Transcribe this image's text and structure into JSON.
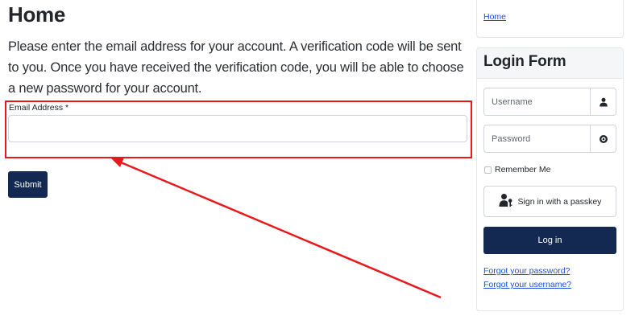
{
  "main": {
    "heading": "Home",
    "intro": "Please enter the email address for your account. A verification code will be sent to you. Once you have received the verification code, you will be able to choose a new password for your account.",
    "email_label": "Email Address *",
    "email_value": "",
    "submit_label": "Submit"
  },
  "sidebar": {
    "breadcrumb": "Home",
    "login_form": {
      "title": "Login Form",
      "username_placeholder": "Username",
      "password_placeholder": "Password",
      "remember_label": "Remember Me",
      "passkey_label": "Sign in with a passkey",
      "login_label": "Log in",
      "forgot_password": "Forgot your password?",
      "forgot_username": "Forgot your username?"
    }
  },
  "icons": {
    "username_addon": "user-icon",
    "password_addon": "eye-icon",
    "passkey": "user-key-icon"
  },
  "colors": {
    "primary_button": "#132951",
    "link": "#1d4ed8",
    "annotation": "#e8191c"
  }
}
